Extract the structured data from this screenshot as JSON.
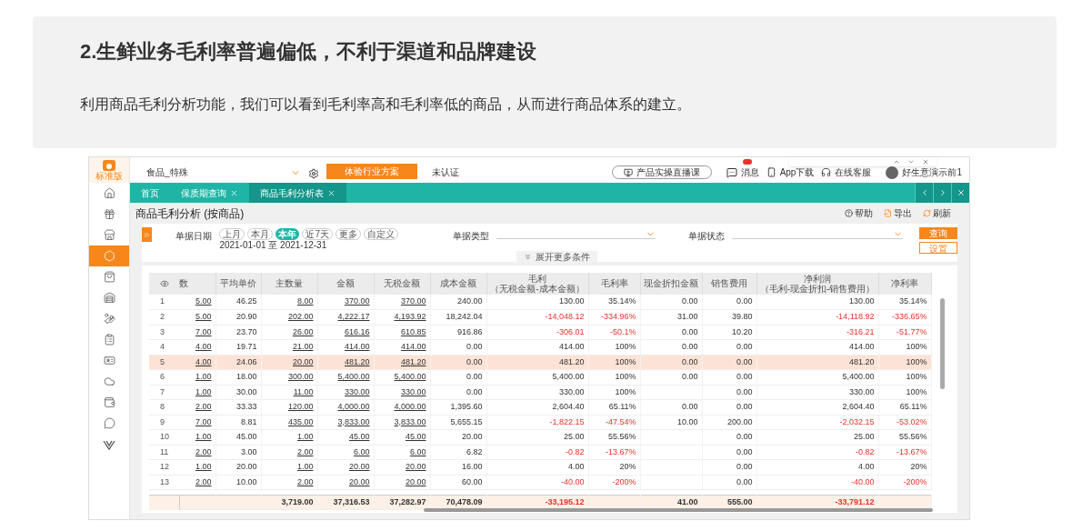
{
  "page": {
    "heading": "2.生鲜业务毛利率普遍偏低，不利于渠道和品牌建设",
    "description": "利用商品毛利分析功能，我们可以看到毛利率高和毛利率低的商品，从而进行商品体系的建立。"
  },
  "app": {
    "logo_label": "标准版",
    "sidebar": {
      "items": [
        {
          "selected": false
        },
        {
          "selected": false
        },
        {
          "selected": false
        },
        {
          "selected": true
        },
        {
          "selected": false
        },
        {
          "selected": false
        },
        {
          "selected": false
        },
        {
          "selected": false
        },
        {
          "selected": false
        },
        {
          "selected": false
        },
        {
          "selected": false
        },
        {
          "selected": false
        },
        {
          "selected": false
        }
      ]
    },
    "topbar": {
      "company": "食品_特殊",
      "plan_button": "体验行业方案",
      "auth_status": "未认证",
      "live_course": "产品实操直播课",
      "messages": "消息",
      "messages_unread": true,
      "app_download": "App下载",
      "service": "在线客服",
      "user": "好生意演示前1"
    },
    "tabs": [
      {
        "label": "首页",
        "closable": false,
        "selected": false
      },
      {
        "label": "保质期查询",
        "closable": true,
        "selected": false
      },
      {
        "label": "商品毛利分析表",
        "closable": true,
        "selected": true
      }
    ],
    "report": {
      "title": "商品毛利分析 (按商品)",
      "actions": [
        "帮助",
        "导出",
        "刷新"
      ],
      "filters": {
        "date_label": "单据日期",
        "periods": [
          {
            "label": "上月",
            "selected": false
          },
          {
            "label": "本月",
            "selected": false
          },
          {
            "label": "本年",
            "selected": true
          },
          {
            "label": "近7天",
            "selected": false
          },
          {
            "label": "更多",
            "selected": false
          },
          {
            "label": "自定义",
            "selected": false
          }
        ],
        "date_range": "2021-01-01 至 2021-12-31",
        "type_label": "单据类型",
        "status_label": "单据状态",
        "query_button": "查询",
        "settings_button": "设置",
        "expand": "展开更多条件"
      },
      "table": {
        "columns": [
          {
            "label": "数",
            "kind": "link"
          },
          {
            "label": "平均单价",
            "kind": "plain"
          },
          {
            "label": "主数量",
            "kind": "link"
          },
          {
            "label": "金额",
            "kind": "link"
          },
          {
            "label": "无税金额",
            "kind": "link"
          },
          {
            "label": "成本金额",
            "kind": "plain"
          },
          {
            "label": "毛利",
            "sublabel": "（无税金额-成本金额）",
            "kind": "profit"
          },
          {
            "label": "毛利率",
            "kind": "profit"
          },
          {
            "label": "现金折扣金额",
            "kind": "plain"
          },
          {
            "label": "销售费用",
            "kind": "plain"
          },
          {
            "label": "净利润",
            "sublabel": "（毛利-现金折扣-销售费用）",
            "kind": "profit"
          },
          {
            "label": "净利率",
            "kind": "profit"
          }
        ],
        "rows": [
          {
            "no": "1",
            "selected": false,
            "loss": false,
            "cells": [
              "5.00",
              "46.25",
              "8.00",
              "370.00",
              "370.00",
              "240.00",
              "130.00",
              "35.14%",
              "0.00",
              "0.00",
              "130.00",
              "35.14%"
            ]
          },
          {
            "no": "2",
            "selected": false,
            "loss": true,
            "cells": [
              "5.00",
              "20.90",
              "202.00",
              "4,222.17",
              "4,193.92",
              "18,242.04",
              "-14,048.12",
              "-334.96%",
              "31.00",
              "39.80",
              "-14,118.92",
              "-336.65%"
            ]
          },
          {
            "no": "3",
            "selected": false,
            "loss": true,
            "cells": [
              "7.00",
              "23.70",
              "26.00",
              "616.16",
              "610.85",
              "916.86",
              "-306.01",
              "-50.1%",
              "0.00",
              "10.20",
              "-316.21",
              "-51.77%"
            ]
          },
          {
            "no": "4",
            "selected": false,
            "loss": false,
            "cells": [
              "4.00",
              "19.71",
              "21.00",
              "414.00",
              "414.00",
              "0.00",
              "414.00",
              "100%",
              "0.00",
              "0.00",
              "414.00",
              "100%"
            ]
          },
          {
            "no": "5",
            "selected": true,
            "loss": false,
            "cells": [
              "4.00",
              "24.06",
              "20.00",
              "481.20",
              "481.20",
              "0.00",
              "481.20",
              "100%",
              "0.00",
              "0.00",
              "481.20",
              "100%"
            ]
          },
          {
            "no": "6",
            "selected": false,
            "loss": false,
            "cells": [
              "1.00",
              "18.00",
              "300.00",
              "5,400.00",
              "5,400.00",
              "0.00",
              "5,400.00",
              "100%",
              "0.00",
              "0.00",
              "5,400.00",
              "100%"
            ]
          },
          {
            "no": "7",
            "selected": false,
            "loss": false,
            "cells": [
              "1.00",
              "30.00",
              "11.00",
              "330.00",
              "330.00",
              "0.00",
              "330.00",
              "100%",
              null,
              "0.00",
              "330.00",
              "100%"
            ]
          },
          {
            "no": "8",
            "selected": false,
            "loss": false,
            "cells": [
              "2.00",
              "33.33",
              "120.00",
              "4,000.00",
              "4,000.00",
              "1,395.60",
              "2,604.40",
              "65.11%",
              "0.00",
              "0.00",
              "2,604.40",
              "65.11%"
            ]
          },
          {
            "no": "9",
            "selected": false,
            "loss": true,
            "cells": [
              "7.00",
              "8.81",
              "435.00",
              "3,833.00",
              "3,833.00",
              "5,655.15",
              "-1,822.15",
              "-47.54%",
              "10.00",
              "200.00",
              "-2,032.15",
              "-53.02%"
            ]
          },
          {
            "no": "10",
            "selected": false,
            "loss": false,
            "cells": [
              "1.00",
              "45.00",
              "1.00",
              "45.00",
              "45.00",
              "20.00",
              "25.00",
              "55.56%",
              null,
              "0.00",
              "25.00",
              "55.56%"
            ]
          },
          {
            "no": "11",
            "selected": false,
            "loss": true,
            "cells": [
              "2.00",
              "3.00",
              "2.00",
              "6.00",
              "6.00",
              "6.82",
              "-0.82",
              "-13.67%",
              null,
              "0.00",
              "-0.82",
              "-13.67%"
            ]
          },
          {
            "no": "12",
            "selected": false,
            "loss": false,
            "cells": [
              "1.00",
              "20.00",
              "1.00",
              "20.00",
              "20.00",
              "16.00",
              "4.00",
              "20%",
              null,
              "0.00",
              "4.00",
              "20%"
            ]
          },
          {
            "no": "13",
            "selected": false,
            "loss": true,
            "cells": [
              "2.00",
              "10.00",
              "2.00",
              "20.00",
              "20.00",
              "60.00",
              "-40.00",
              "-200%",
              null,
              "0.00",
              "-40.00",
              "-200%"
            ]
          }
        ],
        "totals": {
          "loss": true,
          "cells": [
            null,
            null,
            "3,719.00",
            "37,316.53",
            "37,282.97",
            "70,478.09",
            "-33,195.12",
            null,
            "41.00",
            "555.00",
            "-33,791.12",
            null
          ]
        }
      }
    }
  }
}
